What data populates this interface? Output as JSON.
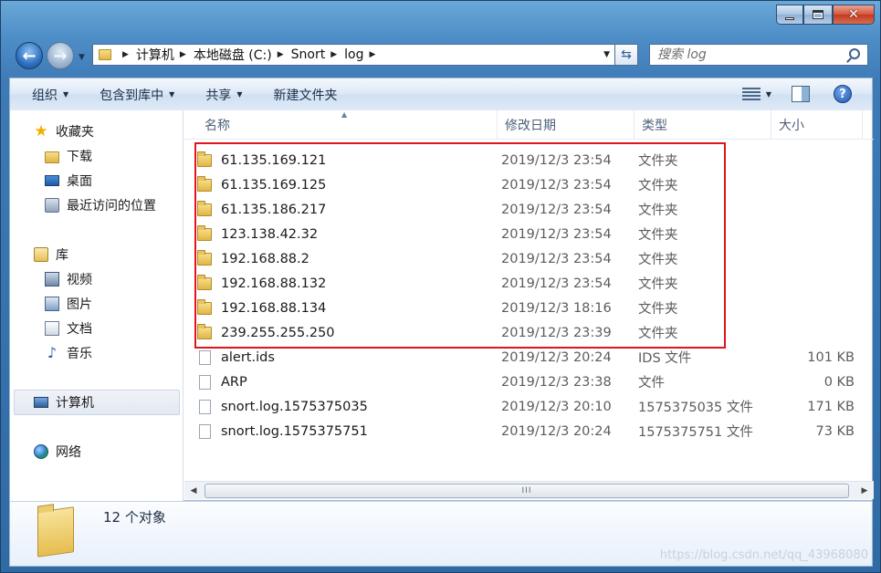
{
  "window": {
    "minimize_icon": "minimize-icon",
    "maximize_icon": "maximize-icon",
    "close_glyph": "✕"
  },
  "nav": {
    "back_glyph": "←",
    "forward_glyph": "→",
    "breadcrumb": [
      "计算机",
      "本地磁盘 (C:)",
      "Snort",
      "log"
    ],
    "refresh_glyph": "⇆"
  },
  "search": {
    "placeholder": "搜索 log"
  },
  "toolbar": {
    "organize": "组织",
    "include_in_library": "包含到库中",
    "share": "共享",
    "new_folder": "新建文件夹",
    "help_glyph": "?"
  },
  "navpane": {
    "favorites": "收藏夹",
    "downloads": "下载",
    "desktop": "桌面",
    "recent": "最近访问的位置",
    "libraries": "库",
    "videos": "视频",
    "pictures": "图片",
    "documents": "文档",
    "music": "音乐",
    "computer": "计算机",
    "network": "网络"
  },
  "columns": {
    "name": "名称",
    "date": "修改日期",
    "type": "类型",
    "size": "大小"
  },
  "files": [
    {
      "name": "61.135.169.121",
      "date": "2019/12/3 23:54",
      "type": "文件夹",
      "size": "",
      "kind": "folder"
    },
    {
      "name": "61.135.169.125",
      "date": "2019/12/3 23:54",
      "type": "文件夹",
      "size": "",
      "kind": "folder"
    },
    {
      "name": "61.135.186.217",
      "date": "2019/12/3 23:54",
      "type": "文件夹",
      "size": "",
      "kind": "folder"
    },
    {
      "name": "123.138.42.32",
      "date": "2019/12/3 23:54",
      "type": "文件夹",
      "size": "",
      "kind": "folder"
    },
    {
      "name": "192.168.88.2",
      "date": "2019/12/3 23:54",
      "type": "文件夹",
      "size": "",
      "kind": "folder"
    },
    {
      "name": "192.168.88.132",
      "date": "2019/12/3 23:54",
      "type": "文件夹",
      "size": "",
      "kind": "folder"
    },
    {
      "name": "192.168.88.134",
      "date": "2019/12/3 18:16",
      "type": "文件夹",
      "size": "",
      "kind": "folder"
    },
    {
      "name": "239.255.255.250",
      "date": "2019/12/3 23:39",
      "type": "文件夹",
      "size": "",
      "kind": "folder"
    },
    {
      "name": "alert.ids",
      "date": "2019/12/3 20:24",
      "type": "IDS 文件",
      "size": "101 KB",
      "kind": "file"
    },
    {
      "name": "ARP",
      "date": "2019/12/3 23:38",
      "type": "文件",
      "size": "0 KB",
      "kind": "file"
    },
    {
      "name": "snort.log.1575375035",
      "date": "2019/12/3 20:10",
      "type": "1575375035 文件",
      "size": "171 KB",
      "kind": "file"
    },
    {
      "name": "snort.log.1575375751",
      "date": "2019/12/3 20:24",
      "type": "1575375751 文件",
      "size": "73 KB",
      "kind": "file"
    }
  ],
  "scrollbar": {
    "grip": "III"
  },
  "details": {
    "count": "12 个对象"
  },
  "watermark": "https://blog.csdn.net/qq_43968080",
  "colors": {
    "highlight_box": "#e0141a",
    "frame": "#3d7ab6"
  }
}
